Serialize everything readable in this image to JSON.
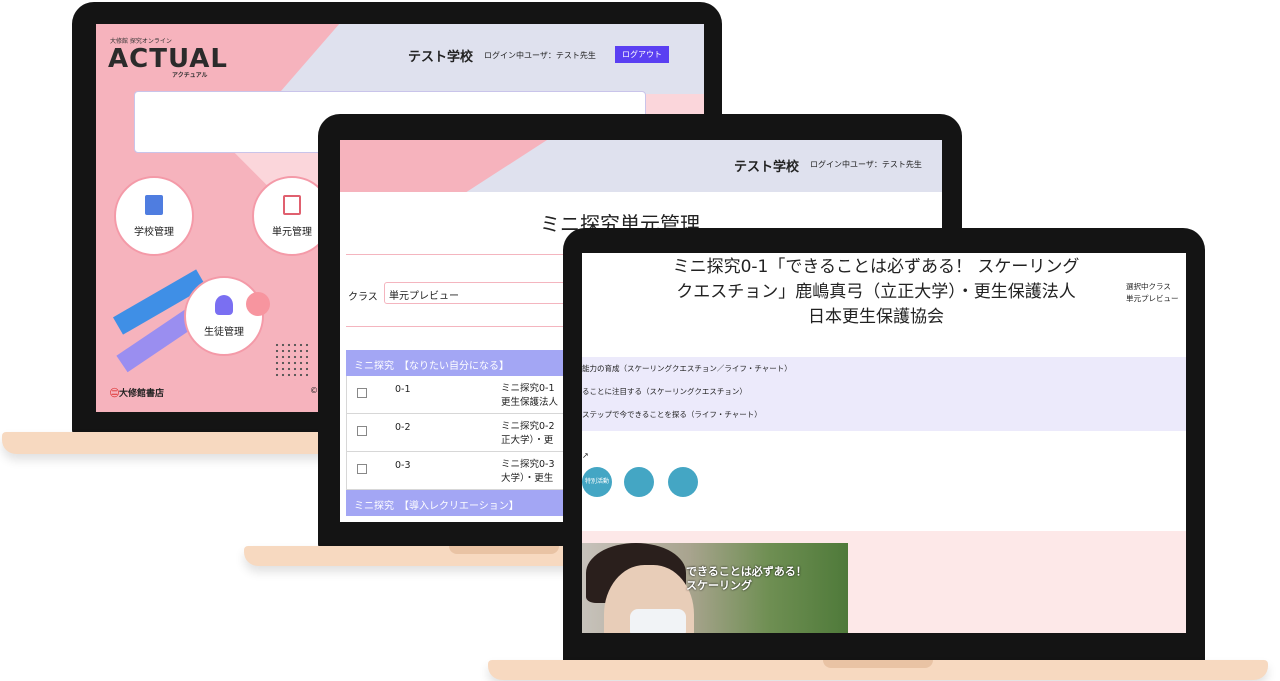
{
  "laptop1": {
    "brand_small": "大修館 探究オンライン",
    "logo": "ACTUAL",
    "logo_kana": "アクチュアル",
    "school": "テスト学校",
    "user": "ログイン中ユーザ：テスト先生",
    "logout": "ログアウト",
    "menu": [
      {
        "label": "学校管理",
        "icon": "school-icon"
      },
      {
        "label": "単元管理",
        "icon": "document-icon"
      },
      {
        "label": "生徒管理",
        "icon": "student-icon"
      }
    ],
    "publisher": "大修館書店",
    "copyright_mark": "©"
  },
  "laptop2": {
    "school": "テスト学校",
    "user": "ログイン中ユーザ：テスト先生",
    "title": "ミニ探究単元管理",
    "class_label": "クラス",
    "class_value": "単元プレビュー",
    "sections": [
      {
        "label": "ミニ探究　【なりたい自分になる】"
      },
      {
        "label": "ミニ探究　【導入レクリエーション】"
      }
    ],
    "rows": [
      {
        "code": "0-1",
        "title_line1": "ミニ探究0-1",
        "title_line2": "更生保護法人"
      },
      {
        "code": "0-2",
        "title_line1": "ミニ探究0-2",
        "title_line2": "正大学）・更"
      },
      {
        "code": "0-3",
        "title_line1": "ミニ探究0-3",
        "title_line2": "大学）・更生"
      }
    ]
  },
  "laptop3": {
    "title_line1": "ミニ探究0-1「できることは必ずある！ スケーリング",
    "title_line2": "クエスチョン」鹿嶋真弓（立正大学）・更生保護法人",
    "title_line3": "日本更生保護協会",
    "selected_class_label": "選択中クラス",
    "selected_class_value": "単元プレビュー",
    "items": [
      "能力の育成（スケーリングクエスチョン／ライフ・チャート）",
      "ることに注目する（スケーリングクエスチョン）",
      "ステップで今できることを探る（ライフ・チャート）"
    ],
    "bubbles": [
      "特別活動",
      "",
      ""
    ],
    "video_text_line1": "できることは必ずある！",
    "video_text_line2": "スケーリング"
  }
}
